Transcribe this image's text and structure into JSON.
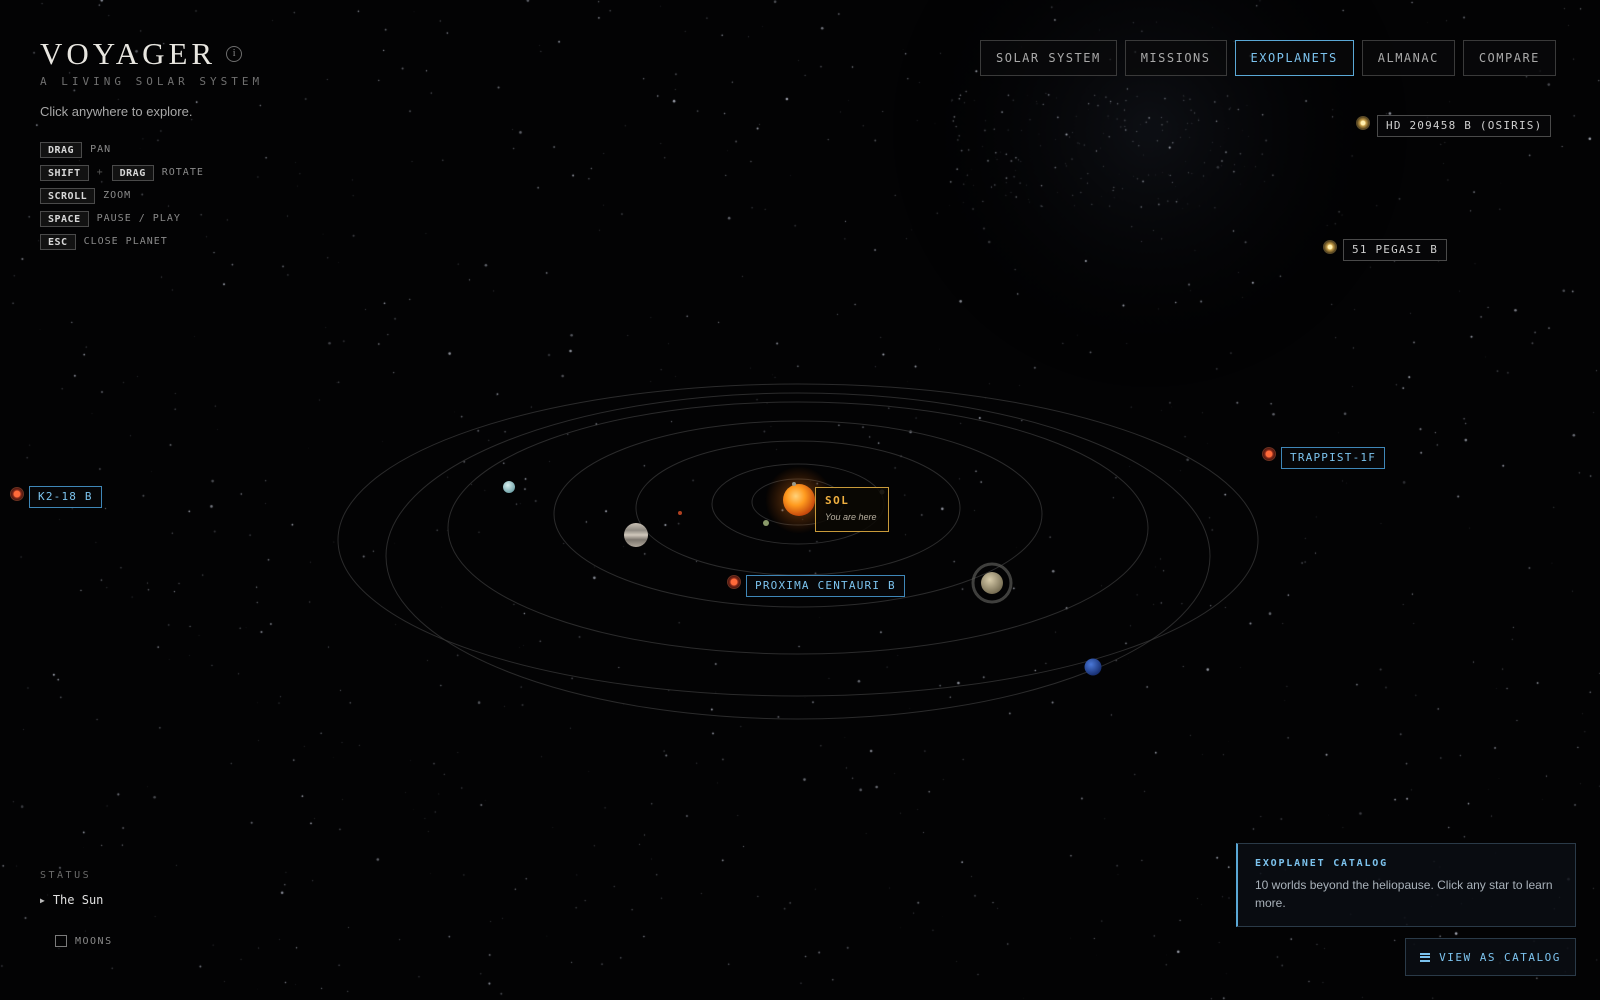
{
  "app": {
    "title": "VOYAGER",
    "subtitle": "A LIVING SOLAR SYSTEM",
    "tagline": "Click anywhere to explore.",
    "info_icon": "info-icon"
  },
  "shortcuts": [
    {
      "keys": [
        "DRAG"
      ],
      "action": "PAN"
    },
    {
      "keys": [
        "SHIFT",
        "DRAG"
      ],
      "joiner": "+",
      "action": "ROTATE"
    },
    {
      "keys": [
        "SCROLL"
      ],
      "action": "ZOOM"
    },
    {
      "keys": [
        "SPACE"
      ],
      "action": "PAUSE / PLAY"
    },
    {
      "keys": [
        "ESC"
      ],
      "action": "CLOSE PLANET"
    }
  ],
  "nav": {
    "tabs": [
      "SOLAR SYSTEM",
      "MISSIONS",
      "EXOPLANETS",
      "ALMANAC",
      "COMPARE"
    ],
    "active": "EXOPLANETS"
  },
  "sol": {
    "name": "SOL",
    "note": "You are here"
  },
  "exoplanets": {
    "hd209458": "HD 209458 B (OSIRIS)",
    "pegasi": "51 PEGASI B",
    "trappist": "TRAPPIST-1F",
    "k218": "K2-18 B",
    "proxima": "PROXIMA CENTAURI B"
  },
  "status": {
    "label": "STATUS",
    "value": "The Sun",
    "moons_label": "MOONS",
    "moons_checked": false
  },
  "catalog": {
    "title": "EXOPLANET CATALOG",
    "description": "10 worlds beyond the heliopause. Click any star to learn more.",
    "button_label": "VIEW AS CATALOG",
    "button_icon": "list-icon"
  },
  "colors": {
    "accent": "#7cc3ee",
    "sun_label": "#f0b040",
    "background": "#030304"
  }
}
